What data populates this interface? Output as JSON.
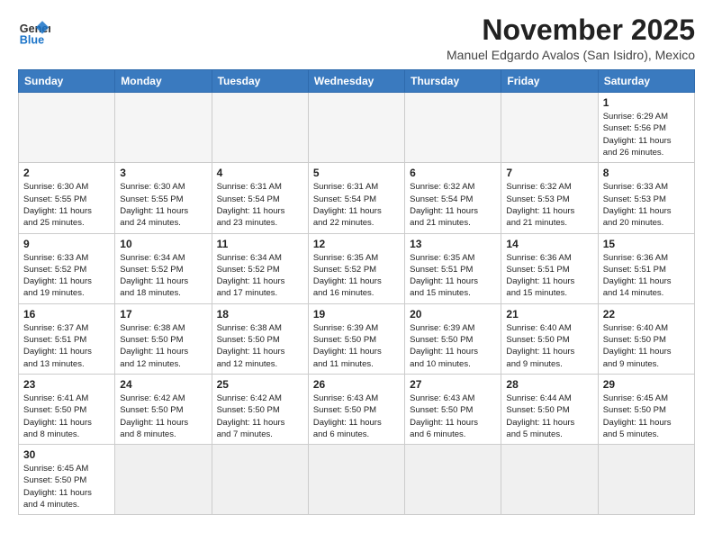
{
  "logo": {
    "text_general": "General",
    "text_blue": "Blue"
  },
  "header": {
    "month_title": "November 2025",
    "subtitle": "Manuel Edgardo Avalos (San Isidro), Mexico"
  },
  "weekdays": [
    "Sunday",
    "Monday",
    "Tuesday",
    "Wednesday",
    "Thursday",
    "Friday",
    "Saturday"
  ],
  "weeks": [
    [
      {
        "day": "",
        "info": ""
      },
      {
        "day": "",
        "info": ""
      },
      {
        "day": "",
        "info": ""
      },
      {
        "day": "",
        "info": ""
      },
      {
        "day": "",
        "info": ""
      },
      {
        "day": "",
        "info": ""
      },
      {
        "day": "1",
        "info": "Sunrise: 6:29 AM\nSunset: 5:56 PM\nDaylight: 11 hours\nand 26 minutes."
      }
    ],
    [
      {
        "day": "2",
        "info": "Sunrise: 6:30 AM\nSunset: 5:55 PM\nDaylight: 11 hours\nand 25 minutes."
      },
      {
        "day": "3",
        "info": "Sunrise: 6:30 AM\nSunset: 5:55 PM\nDaylight: 11 hours\nand 24 minutes."
      },
      {
        "day": "4",
        "info": "Sunrise: 6:31 AM\nSunset: 5:54 PM\nDaylight: 11 hours\nand 23 minutes."
      },
      {
        "day": "5",
        "info": "Sunrise: 6:31 AM\nSunset: 5:54 PM\nDaylight: 11 hours\nand 22 minutes."
      },
      {
        "day": "6",
        "info": "Sunrise: 6:32 AM\nSunset: 5:54 PM\nDaylight: 11 hours\nand 21 minutes."
      },
      {
        "day": "7",
        "info": "Sunrise: 6:32 AM\nSunset: 5:53 PM\nDaylight: 11 hours\nand 21 minutes."
      },
      {
        "day": "8",
        "info": "Sunrise: 6:33 AM\nSunset: 5:53 PM\nDaylight: 11 hours\nand 20 minutes."
      }
    ],
    [
      {
        "day": "9",
        "info": "Sunrise: 6:33 AM\nSunset: 5:52 PM\nDaylight: 11 hours\nand 19 minutes."
      },
      {
        "day": "10",
        "info": "Sunrise: 6:34 AM\nSunset: 5:52 PM\nDaylight: 11 hours\nand 18 minutes."
      },
      {
        "day": "11",
        "info": "Sunrise: 6:34 AM\nSunset: 5:52 PM\nDaylight: 11 hours\nand 17 minutes."
      },
      {
        "day": "12",
        "info": "Sunrise: 6:35 AM\nSunset: 5:52 PM\nDaylight: 11 hours\nand 16 minutes."
      },
      {
        "day": "13",
        "info": "Sunrise: 6:35 AM\nSunset: 5:51 PM\nDaylight: 11 hours\nand 15 minutes."
      },
      {
        "day": "14",
        "info": "Sunrise: 6:36 AM\nSunset: 5:51 PM\nDaylight: 11 hours\nand 15 minutes."
      },
      {
        "day": "15",
        "info": "Sunrise: 6:36 AM\nSunset: 5:51 PM\nDaylight: 11 hours\nand 14 minutes."
      }
    ],
    [
      {
        "day": "16",
        "info": "Sunrise: 6:37 AM\nSunset: 5:51 PM\nDaylight: 11 hours\nand 13 minutes."
      },
      {
        "day": "17",
        "info": "Sunrise: 6:38 AM\nSunset: 5:50 PM\nDaylight: 11 hours\nand 12 minutes."
      },
      {
        "day": "18",
        "info": "Sunrise: 6:38 AM\nSunset: 5:50 PM\nDaylight: 11 hours\nand 12 minutes."
      },
      {
        "day": "19",
        "info": "Sunrise: 6:39 AM\nSunset: 5:50 PM\nDaylight: 11 hours\nand 11 minutes."
      },
      {
        "day": "20",
        "info": "Sunrise: 6:39 AM\nSunset: 5:50 PM\nDaylight: 11 hours\nand 10 minutes."
      },
      {
        "day": "21",
        "info": "Sunrise: 6:40 AM\nSunset: 5:50 PM\nDaylight: 11 hours\nand 9 minutes."
      },
      {
        "day": "22",
        "info": "Sunrise: 6:40 AM\nSunset: 5:50 PM\nDaylight: 11 hours\nand 9 minutes."
      }
    ],
    [
      {
        "day": "23",
        "info": "Sunrise: 6:41 AM\nSunset: 5:50 PM\nDaylight: 11 hours\nand 8 minutes."
      },
      {
        "day": "24",
        "info": "Sunrise: 6:42 AM\nSunset: 5:50 PM\nDaylight: 11 hours\nand 8 minutes."
      },
      {
        "day": "25",
        "info": "Sunrise: 6:42 AM\nSunset: 5:50 PM\nDaylight: 11 hours\nand 7 minutes."
      },
      {
        "day": "26",
        "info": "Sunrise: 6:43 AM\nSunset: 5:50 PM\nDaylight: 11 hours\nand 6 minutes."
      },
      {
        "day": "27",
        "info": "Sunrise: 6:43 AM\nSunset: 5:50 PM\nDaylight: 11 hours\nand 6 minutes."
      },
      {
        "day": "28",
        "info": "Sunrise: 6:44 AM\nSunset: 5:50 PM\nDaylight: 11 hours\nand 5 minutes."
      },
      {
        "day": "29",
        "info": "Sunrise: 6:45 AM\nSunset: 5:50 PM\nDaylight: 11 hours\nand 5 minutes."
      }
    ],
    [
      {
        "day": "30",
        "info": "Sunrise: 6:45 AM\nSunset: 5:50 PM\nDaylight: 11 hours\nand 4 minutes."
      },
      {
        "day": "",
        "info": ""
      },
      {
        "day": "",
        "info": ""
      },
      {
        "day": "",
        "info": ""
      },
      {
        "day": "",
        "info": ""
      },
      {
        "day": "",
        "info": ""
      },
      {
        "day": "",
        "info": ""
      }
    ]
  ]
}
